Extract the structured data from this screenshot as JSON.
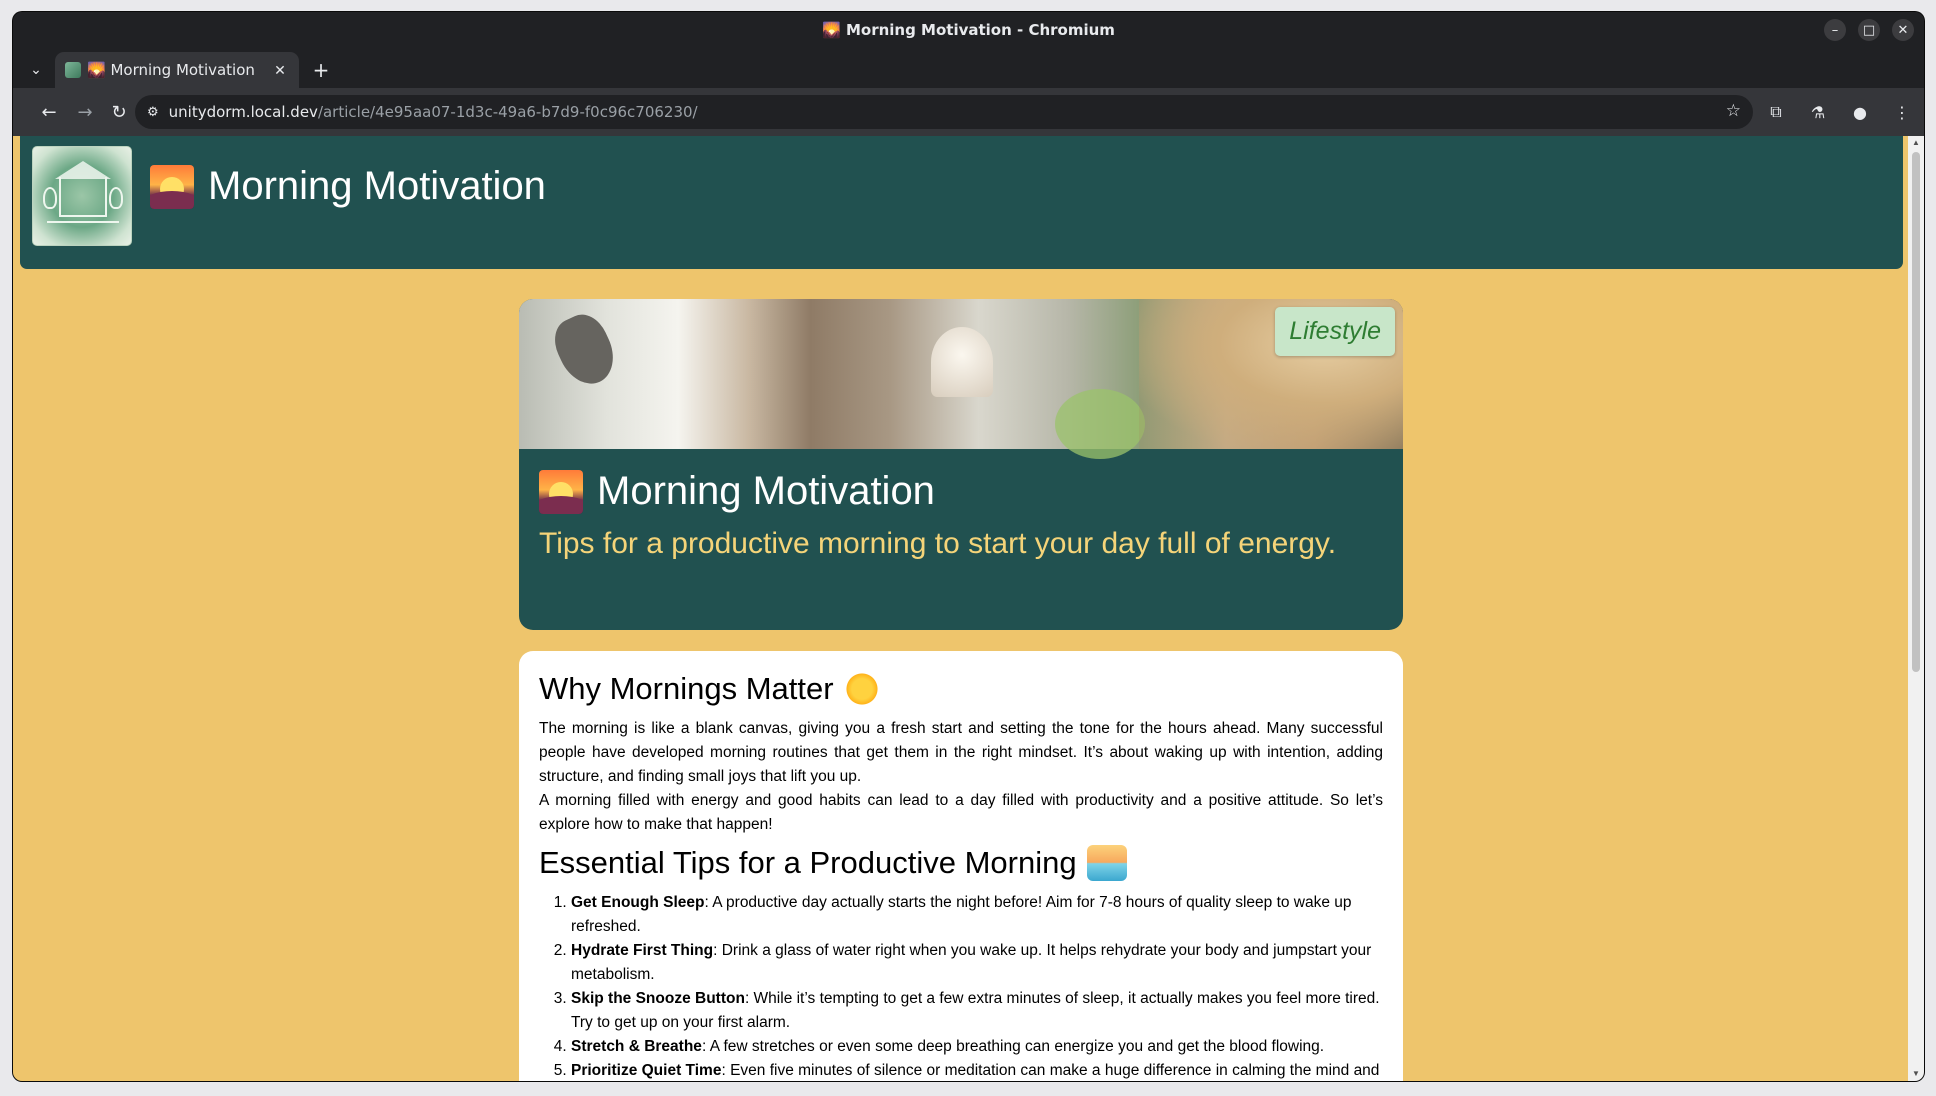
{
  "browser": {
    "window_title": "🌄 Morning Motivation - Chromium",
    "tab_title": "🌄 Morning Motivation",
    "url_host": "unitydorm.local.dev",
    "url_path": "/article/4e95aa07-1d3c-49a6-b7d9-f0c96c706230/"
  },
  "site": {
    "title": "Morning Motivation"
  },
  "article": {
    "category": "Lifestyle",
    "title": "Morning Motivation",
    "subtitle": "Tips for a productive morning to start your day full of energy.",
    "section1_heading": "Why Mornings Matter",
    "section1_p1": "The morning is like a blank canvas, giving you a fresh start and setting the tone for the hours ahead. Many successful people have developed morning routines that get them in the right mindset. It’s about waking up with intention, adding structure, and finding small joys that lift you up.",
    "section1_p2": "A morning filled with energy and good habits can lead to a day filled with productivity and a positive attitude. So let’s explore how to make that happen!",
    "section2_heading": "Essential Tips for a Productive Morning",
    "tips": [
      {
        "title": "Get Enough Sleep",
        "text": ": A productive day actually starts the night before! Aim for 7-8 hours of quality sleep to wake up refreshed."
      },
      {
        "title": "Hydrate First Thing",
        "text": ": Drink a glass of water right when you wake up. It helps rehydrate your body and jumpstart your metabolism."
      },
      {
        "title": "Skip the Snooze Button",
        "text": ": While it’s tempting to get a few extra minutes of sleep, it actually makes you feel more tired. Try to get up on your first alarm."
      },
      {
        "title": "Stretch & Breathe",
        "text": ": A few stretches or even some deep breathing can energize you and get the blood flowing."
      },
      {
        "title": "Prioritize Quiet Time",
        "text": ": Even five minutes of silence or meditation can make a huge difference in calming the mind and setting your intentions."
      }
    ]
  },
  "icons": {
    "sunrise": "sunrise-emoji",
    "sun": "sun-emoji",
    "sunrise_sea": "sunrise-over-sea-emoji"
  }
}
